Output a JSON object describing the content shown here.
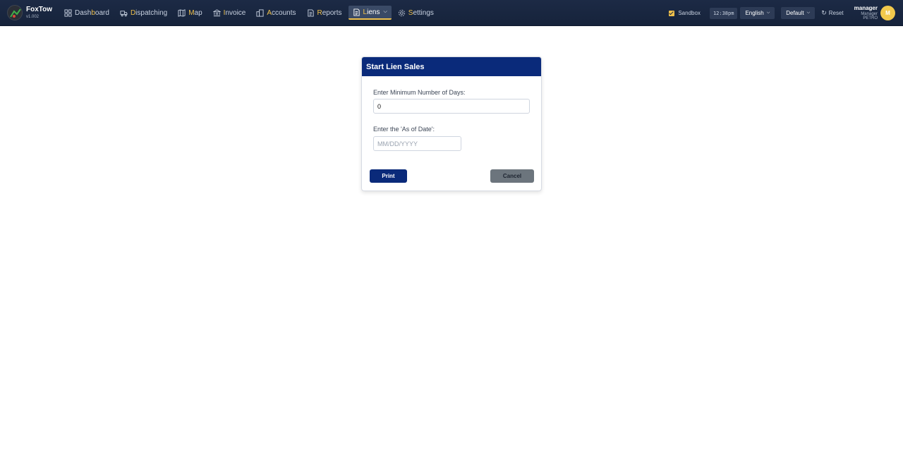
{
  "brand": {
    "name": "FoxTow",
    "version": "v1.002"
  },
  "nav": {
    "items": [
      {
        "key": "dashboard",
        "pre": "Dash",
        "hotkey": "b",
        "post": "oard"
      },
      {
        "key": "dispatching",
        "pre": "",
        "hotkey": "D",
        "post": "ispatching"
      },
      {
        "key": "map",
        "pre": "",
        "hotkey": "M",
        "post": "ap"
      },
      {
        "key": "invoice",
        "pre": "",
        "hotkey": "I",
        "post": "nvoice"
      },
      {
        "key": "accounts",
        "pre": "",
        "hotkey": "A",
        "post": "ccounts"
      },
      {
        "key": "reports",
        "pre": "",
        "hotkey": "R",
        "post": "eports"
      },
      {
        "key": "liens",
        "pre": "",
        "hotkey": "L",
        "post": "iens"
      },
      {
        "key": "settings",
        "pre": "",
        "hotkey": "S",
        "post": "ettings"
      }
    ],
    "active": "liens"
  },
  "header": {
    "sandbox_label": "Sandbox",
    "time": "12:38pm",
    "language": "English",
    "profile": "Default",
    "reset_label": "Reset"
  },
  "user": {
    "name": "manager",
    "role": "Manager",
    "org": "PETRO",
    "initial": "M"
  },
  "modal": {
    "title": "Start Lien Sales",
    "min_days_label": "Enter Minimum Number of Days:",
    "min_days_value": "0",
    "as_of_label": "Enter the 'As of Date':",
    "as_of_placeholder": "MM/DD/YYYY",
    "print_label": "Print",
    "cancel_label": "Cancel"
  },
  "colors": {
    "topbar": "#1c2a45",
    "accent": "#f0c14b",
    "modal_header": "#0a2a7a",
    "cancel": "#6c757d"
  }
}
